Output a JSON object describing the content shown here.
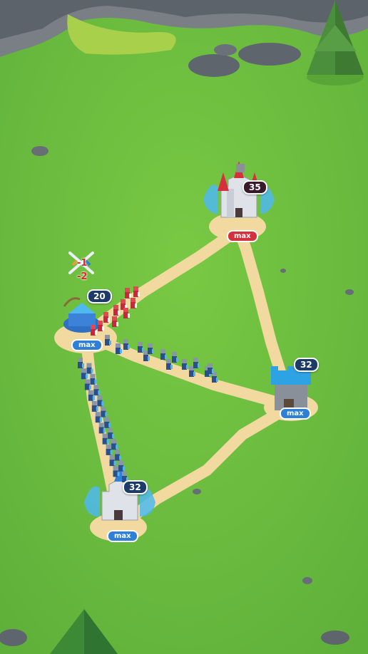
{
  "buildings": [
    {
      "id": "red-castle",
      "team": "red",
      "troops": "35",
      "level": "max"
    },
    {
      "id": "blue-camp",
      "team": "blue",
      "troops": "20",
      "level": "max"
    },
    {
      "id": "blue-tower",
      "team": "blue",
      "troops": "32",
      "level": "max"
    },
    {
      "id": "blue-castle",
      "team": "blue",
      "troops": "32",
      "level": "max"
    }
  ],
  "battle": {
    "icon": "crossed-swords-icon",
    "damage": [
      "-1",
      "-2"
    ]
  },
  "colors": {
    "grass": "#6cbf3c",
    "path": "#f2d9a0",
    "blue_team": "#2f7fd6",
    "red_team": "#d4313d"
  }
}
